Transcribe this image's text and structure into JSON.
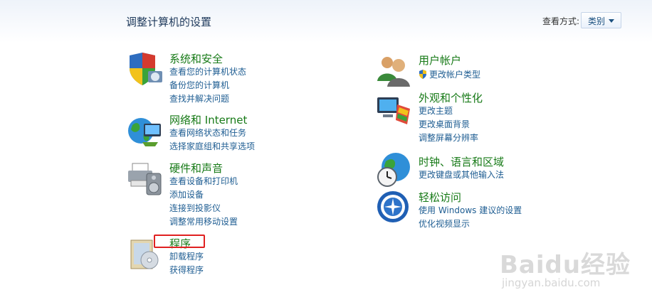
{
  "header": {
    "title": "调整计算机的设置",
    "view_by_label": "查看方式:",
    "view_by_value": "类别"
  },
  "categories": {
    "system": {
      "title": "系统和安全",
      "icon": "shield-computer-icon",
      "links": [
        "查看您的计算机状态",
        "备份您的计算机",
        "查找并解决问题"
      ]
    },
    "network": {
      "title": "网络和 Internet",
      "icon": "network-globe-icon",
      "links": [
        "查看网络状态和任务",
        "选择家庭组和共享选项"
      ]
    },
    "hardware": {
      "title": "硬件和声音",
      "icon": "printer-speaker-icon",
      "links": [
        "查看设备和打印机",
        "添加设备",
        "连接到投影仪",
        "调整常用移动设置"
      ]
    },
    "programs": {
      "title": "程序",
      "icon": "programs-box-icon",
      "links": [
        "卸载程序",
        "获得程序"
      ]
    },
    "users": {
      "title": "用户帐户",
      "icon": "users-icon",
      "links": [
        "更改帐户类型"
      ]
    },
    "appearance": {
      "title": "外观和个性化",
      "icon": "monitor-palette-icon",
      "links": [
        "更改主题",
        "更改桌面背景",
        "调整屏幕分辨率"
      ]
    },
    "clock": {
      "title": "时钟、语言和区域",
      "icon": "clock-globe-icon",
      "links": [
        "更改键盘或其他输入法"
      ]
    },
    "ease": {
      "title": "轻松访问",
      "icon": "ease-of-access-icon",
      "links": [
        "使用 Windows 建议的设置",
        "优化视频显示"
      ]
    }
  },
  "watermark": {
    "text": "Baidu经验",
    "sub": "jingyan.baidu.com"
  },
  "colors": {
    "category_title": "#177a17",
    "link": "#1e5d92",
    "highlight": "#e02020"
  }
}
